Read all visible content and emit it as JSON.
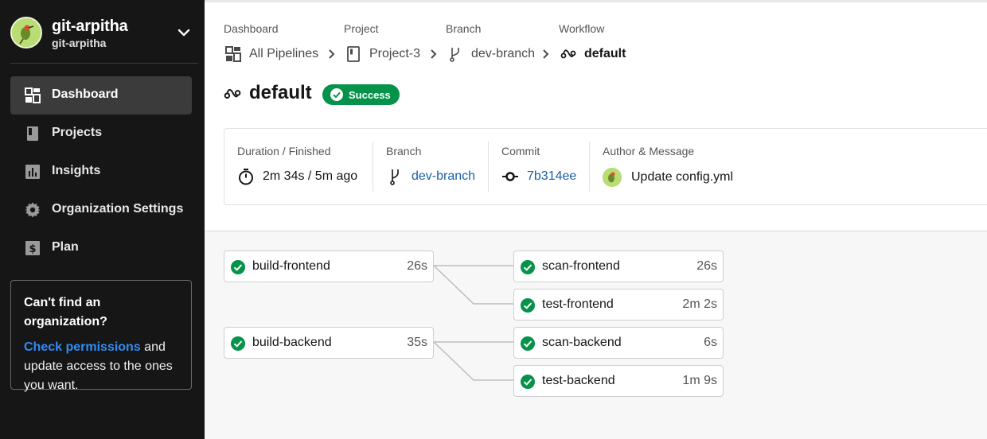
{
  "org": {
    "name": "git-arpitha",
    "subname": "git-arpitha"
  },
  "nav": {
    "items": [
      {
        "label": "Dashboard",
        "icon": "dashboard-icon",
        "active": true
      },
      {
        "label": "Projects",
        "icon": "project-icon",
        "active": false
      },
      {
        "label": "Insights",
        "icon": "insights-icon",
        "active": false
      },
      {
        "label": "Organization Settings",
        "icon": "gear-icon",
        "active": false
      },
      {
        "label": "Plan",
        "icon": "dollar-icon",
        "active": false
      }
    ]
  },
  "help": {
    "title": "Can't find an organization?",
    "link": "Check permissions",
    "text_after_link": " and update access to the ones you want."
  },
  "breadcrumb": {
    "labels": [
      "Dashboard",
      "Project",
      "Branch",
      "Workflow"
    ],
    "links": [
      {
        "text": "All Pipelines",
        "icon": "pipelines-icon"
      },
      {
        "text": "Project-3",
        "icon": "project-icon"
      },
      {
        "text": "dev-branch",
        "icon": "branch-icon"
      },
      {
        "text": "default",
        "icon": "workflow-icon"
      }
    ]
  },
  "workflow": {
    "title": "default",
    "status": "Success",
    "status_color": "#049349"
  },
  "info": {
    "duration_label": "Duration / Finished",
    "duration_value": "2m 34s / 5m ago",
    "branch_label": "Branch",
    "branch_value": "dev-branch",
    "commit_label": "Commit",
    "commit_value": "7b314ee",
    "author_label": "Author & Message",
    "author_message": "Update config.yml"
  },
  "jobs": [
    {
      "name": "build-frontend",
      "time": "26s",
      "status": "success"
    },
    {
      "name": "scan-frontend",
      "time": "26s",
      "status": "success"
    },
    {
      "name": "test-frontend",
      "time": "2m 2s",
      "status": "success"
    },
    {
      "name": "build-backend",
      "time": "35s",
      "status": "success"
    },
    {
      "name": "scan-backend",
      "time": "6s",
      "status": "success"
    },
    {
      "name": "test-backend",
      "time": "1m 9s",
      "status": "success"
    }
  ],
  "colors": {
    "sidebar_bg": "#161616",
    "link_blue": "#1a5fa8",
    "help_link": "#2f8cf5",
    "success_green": "#049349"
  }
}
